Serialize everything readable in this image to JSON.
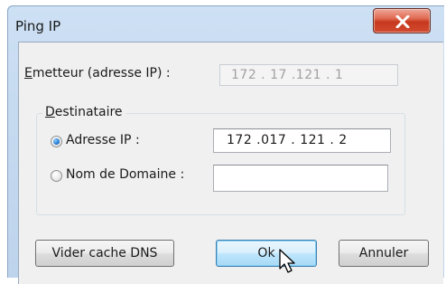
{
  "window": {
    "title": "Ping IP",
    "close_icon": "close-x-icon"
  },
  "emetteur": {
    "label_underlined": "E",
    "label_rest": "metteur (adresse IP) :",
    "ip_value": "172 . 17 .121 . 1"
  },
  "destinataire": {
    "group_label_underlined": "D",
    "group_label_rest": "estinataire",
    "adresse_ip": {
      "label": "Adresse IP :",
      "selected": true,
      "value": "172 .017 . 121 . 2"
    },
    "nom_domaine": {
      "label": "Nom de Domaine :",
      "selected": false,
      "value": ""
    }
  },
  "buttons": {
    "vider_cache": "Vider cache DNS",
    "ok": "Ok",
    "annuler": "Annuler"
  },
  "colors": {
    "accent": "#3c7fb1",
    "close": "#c7391e"
  },
  "cursor_icon": "arrow-pointer-icon"
}
